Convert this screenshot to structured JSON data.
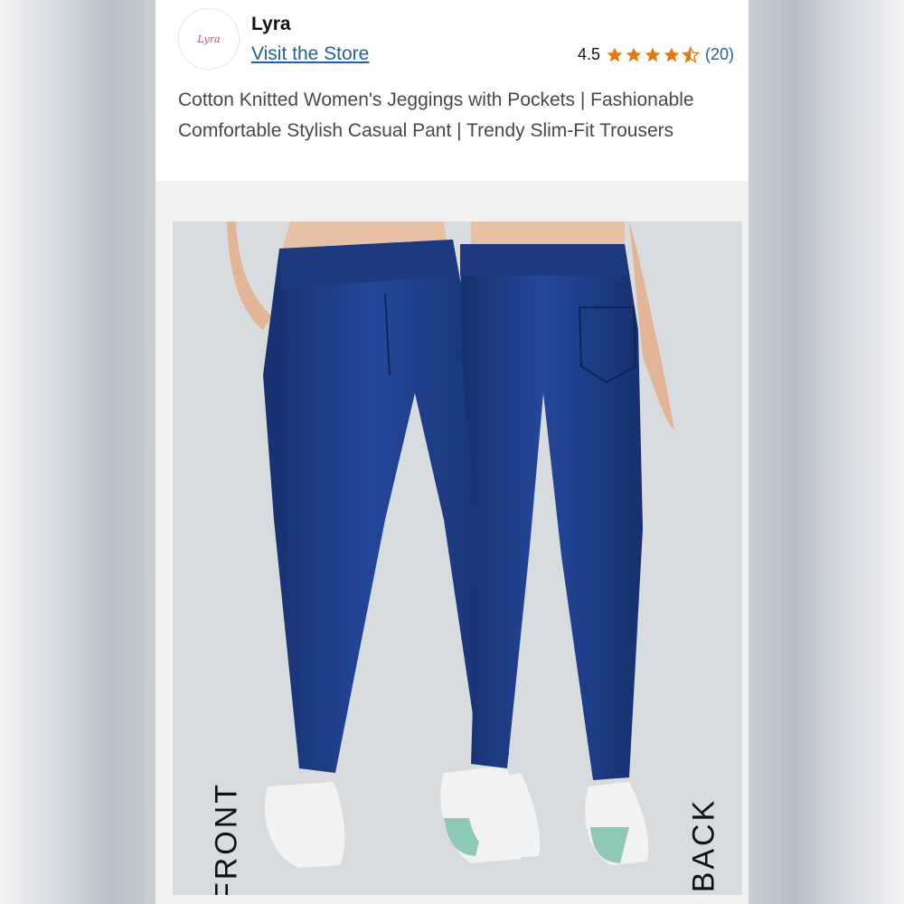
{
  "header": {
    "logo_text": "Lyra",
    "brand": "Lyra",
    "visit_store": "Visit the Store",
    "rating_value": "4.5",
    "rating_stars": 4.5,
    "rating_count": "(20)",
    "star_color": "#e47911"
  },
  "product": {
    "title": "Cotton Knitted Women's Jeggings with Pockets | Fashionable Comfortable Stylish Casual Pant | Trendy Slim-Fit Trousers"
  },
  "image": {
    "front_label": "FRONT",
    "back_label": "BACK",
    "denim_color": "#1f3d85"
  }
}
